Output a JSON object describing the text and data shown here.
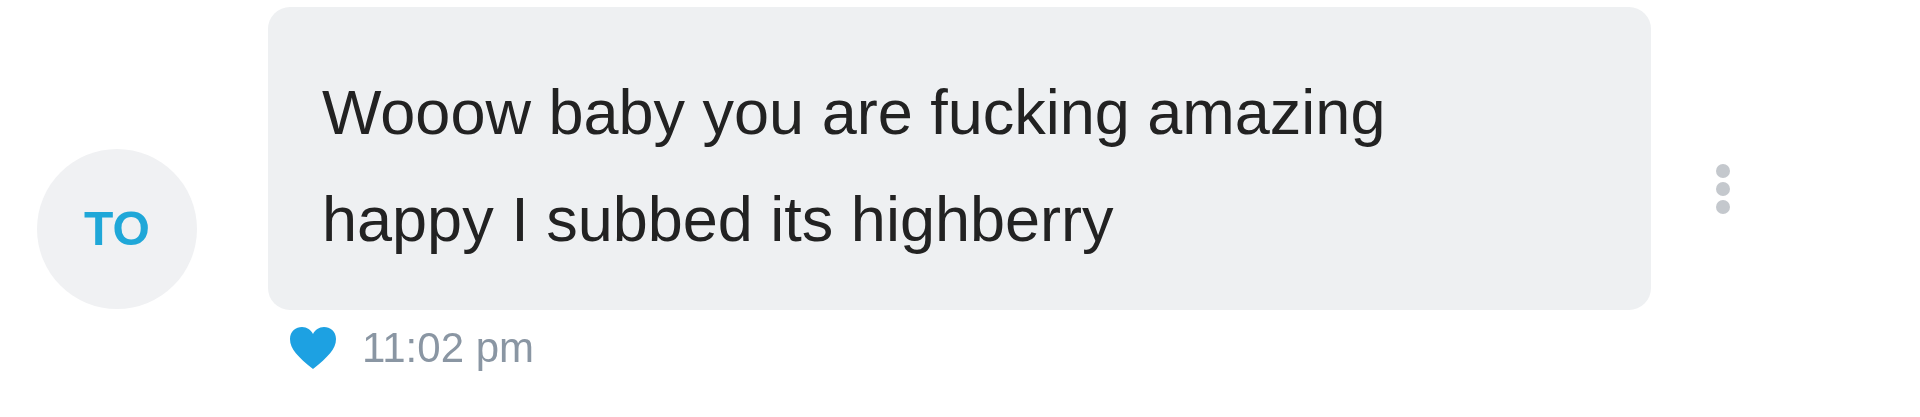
{
  "avatar": {
    "initials": "TO"
  },
  "message": {
    "lines": [
      "Wooow baby you are fucking amazing",
      "happy I subbed its highberry"
    ],
    "liked": true
  },
  "time": "11:02 pm"
}
